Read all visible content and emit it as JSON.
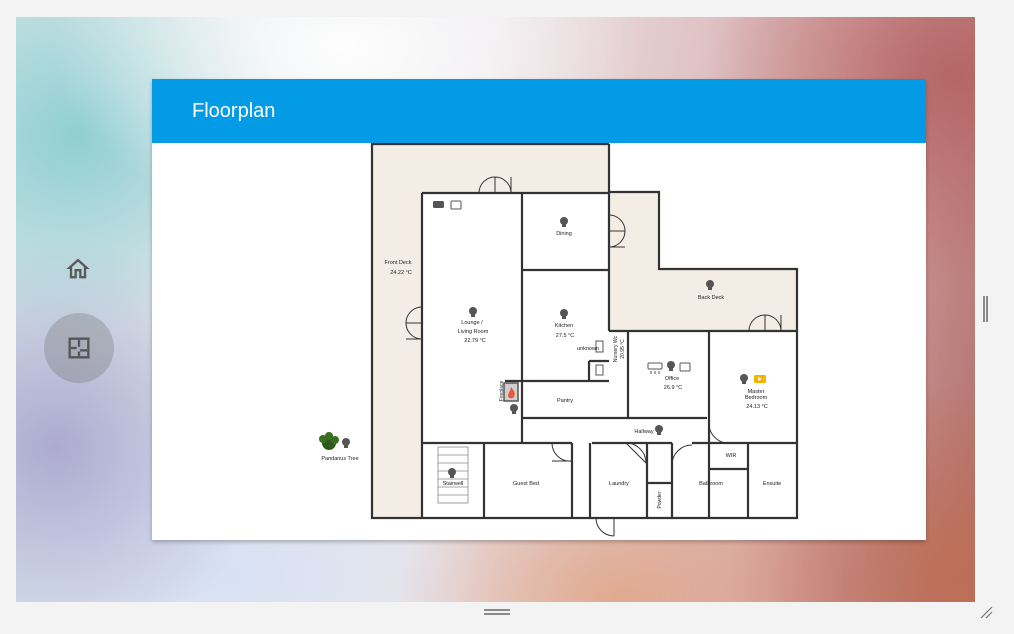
{
  "card": {
    "title": "Floorplan"
  },
  "nav": {
    "items": [
      {
        "icon": "home-icon"
      },
      {
        "icon": "floorplan-icon",
        "active": true
      }
    ]
  },
  "rooms": {
    "front_deck": {
      "label": "Front Deck",
      "temp": "24.22 °C"
    },
    "dining": {
      "label": "Dining"
    },
    "back_deck": {
      "label": "Back Deck"
    },
    "lounge": {
      "label_line1": "Lounge /",
      "label_line2": "Living Room",
      "temp": "22.79 °C"
    },
    "kitchen": {
      "label": "Kitchen",
      "temp": "27.5 °C"
    },
    "unknown": {
      "label": "unknown"
    },
    "nursery": {
      "label": "Nursery Wc",
      "temp": "20.95 °C"
    },
    "office": {
      "label": "Office",
      "temp": "26.9 °C"
    },
    "master": {
      "label_line1": "Master",
      "label_line2": "Bedroom",
      "temp": "24.13 °C"
    },
    "fireplace": {
      "label": "Fireplace"
    },
    "pantry": {
      "label": "Pantry"
    },
    "hallway": {
      "label": "Hallway"
    },
    "pandanus": {
      "label": "Pandanus Tree"
    },
    "wir": {
      "label": "WIR"
    },
    "stairwell": {
      "label": "Stairwell"
    },
    "guest_bed": {
      "label": "Guest Bed"
    },
    "laundry": {
      "label": "Laundry"
    },
    "powder": {
      "label": "Powder"
    },
    "bathroom": {
      "label": "Bathroom"
    },
    "ensuite": {
      "label": "Ensuite"
    }
  },
  "colors": {
    "header": "#039be5",
    "deck": "#f4ede6",
    "wall": "#333333",
    "accent_media": "#f3b400"
  }
}
